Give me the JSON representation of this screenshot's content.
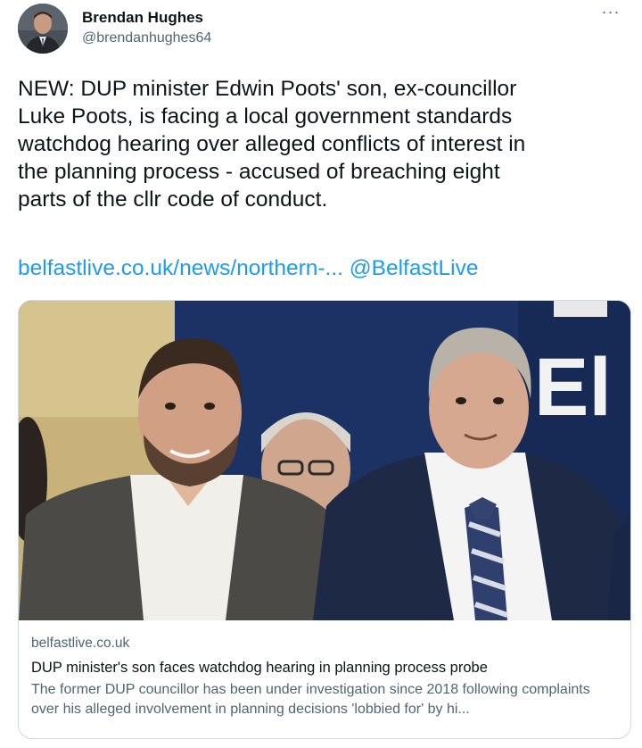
{
  "author": {
    "display_name": "Brendan Hughes",
    "handle": "@brendanhughes64",
    "avatar_icon": "user-photo-icon"
  },
  "more_icon": "more-options-icon",
  "more_label": "···",
  "tweet": {
    "text": "NEW: DUP minister Edwin Poots' son, ex-councillor\nLuke Poots, is facing a local government standards\nwatchdog hearing over alleged conflicts of interest in\nthe planning process - accused of breaching eight\nparts of the cllr code of conduct.",
    "link_text": "belfastlive.co.uk/news/northern-...",
    "mention": "@BelfastLive"
  },
  "card": {
    "image_alt": "Photo of two men in suits at an event",
    "backdrop_text": "El",
    "domain": "belfastlive.co.uk",
    "title": "DUP minister's son faces watchdog hearing in planning process probe",
    "description": "The former DUP councillor has been under investigation since 2018 following complaints over his alleged involvement in planning decisions 'lobbied for' by hi..."
  },
  "colors": {
    "link": "#1d9bf0",
    "text": "#0f1419",
    "secondary": "#536471",
    "border": "#cfd9de"
  }
}
